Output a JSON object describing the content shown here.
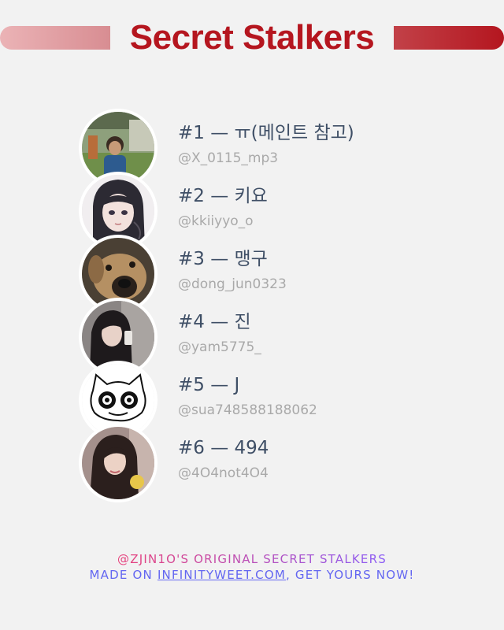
{
  "header": {
    "title": "Secret Stalkers"
  },
  "stalkers": [
    {
      "rank_name": "#1 — ㅠ(메인트 참고)",
      "handle": "@X_0115_mp3",
      "avatar_icon": "boy-photo-avatar"
    },
    {
      "rank_name": "#2 — 키요",
      "handle": "@kkiiyyo_o",
      "avatar_icon": "anime-girl-avatar"
    },
    {
      "rank_name": "#3 — 맹구",
      "handle": "@dong_jun0323",
      "avatar_icon": "dog-face-avatar"
    },
    {
      "rank_name": "#4 — 진",
      "handle": "@yam5775_",
      "avatar_icon": "mirror-selfie-avatar"
    },
    {
      "rank_name": "#5 — J",
      "handle": "@sua748588188062",
      "avatar_icon": "cat-doodle-avatar"
    },
    {
      "rank_name": "#6 — 494",
      "handle": "@4O4not4O4",
      "avatar_icon": "girl-photo-avatar"
    }
  ],
  "footer": {
    "line1": "@ZJIN1O'S ORIGINAL SECRET STALKERS",
    "line2_prefix": "MADE ON ",
    "line2_link": "INFINITYWEET.COM",
    "line2_suffix": ", GET YOURS NOW!"
  },
  "colors": {
    "title": "#b5161f",
    "name_text": "#3f4f66",
    "handle_text": "#a9a9a9",
    "footer_pink": "#e8407a",
    "footer_violet": "#6366f1"
  }
}
